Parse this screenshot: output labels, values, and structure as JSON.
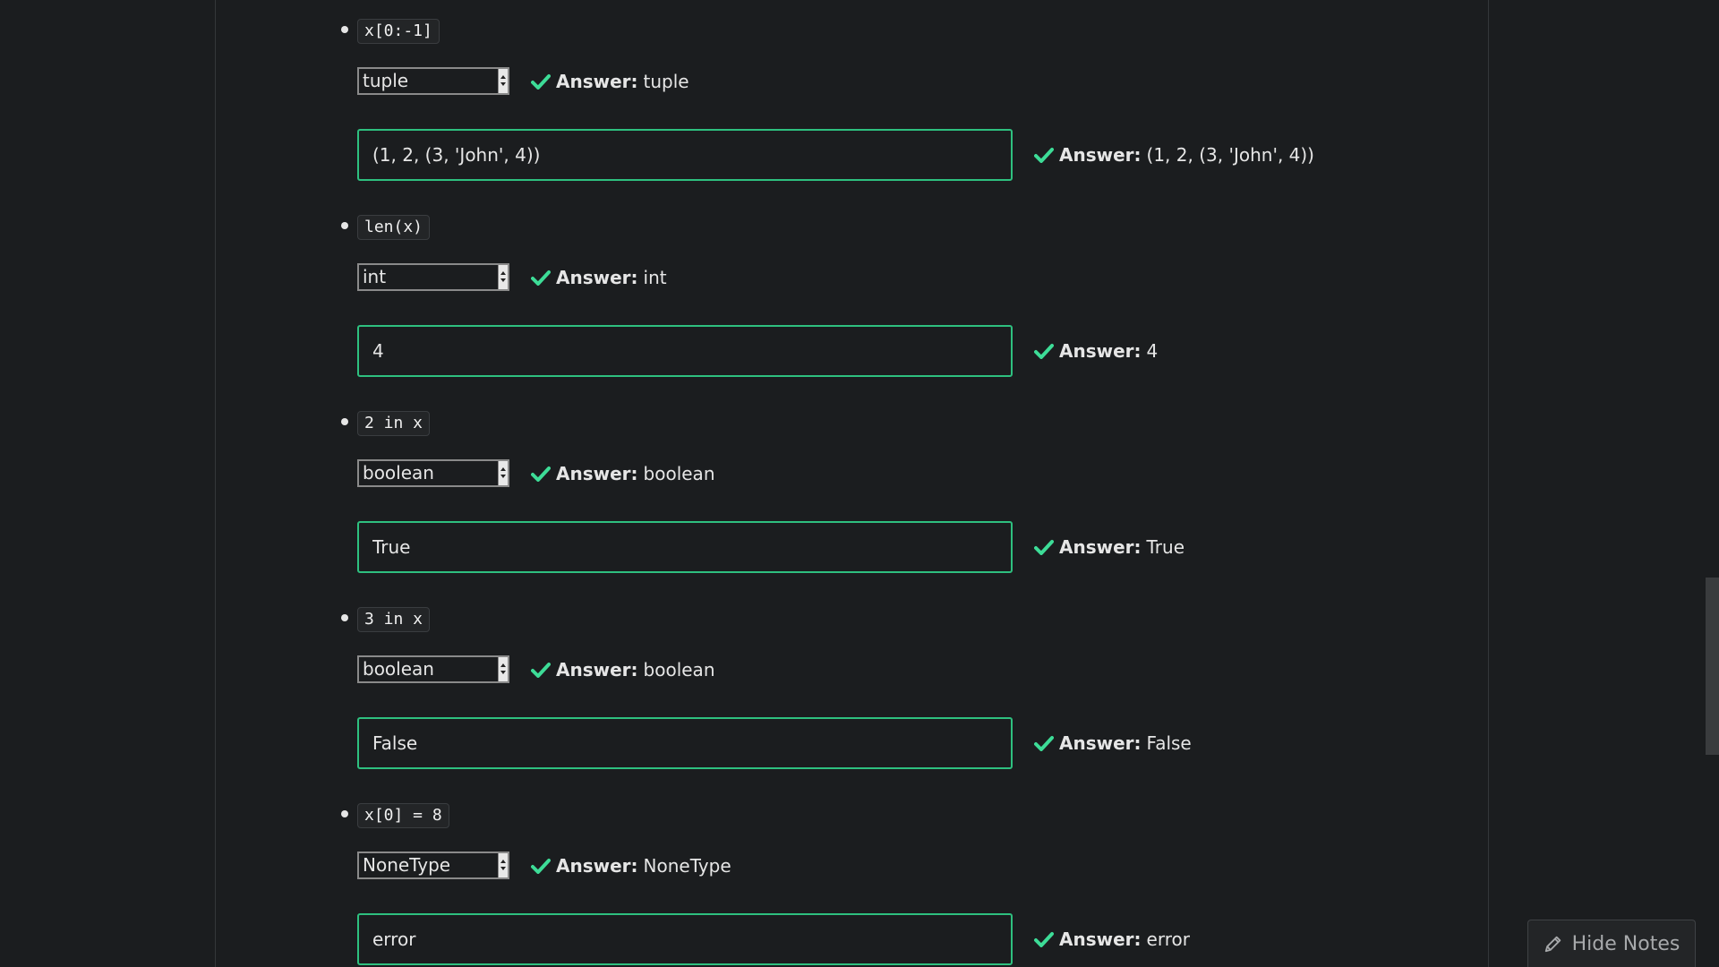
{
  "questions": [
    {
      "code": "x[0:-1]",
      "type_selected": "tuple",
      "type_answer": "tuple",
      "value": "(1, 2, (3, 'John', 4))",
      "value_answer": "(1, 2, (3, 'John', 4))"
    },
    {
      "code": "len(x)",
      "type_selected": "int",
      "type_answer": "int",
      "value": "4",
      "value_answer": "4"
    },
    {
      "code": "2 in x",
      "type_selected": "boolean",
      "type_answer": "boolean",
      "value": "True",
      "value_answer": "True"
    },
    {
      "code": "3 in x",
      "type_selected": "boolean",
      "type_answer": "boolean",
      "value": "False",
      "value_answer": "False"
    },
    {
      "code": "x[0] = 8",
      "type_selected": "NoneType",
      "type_answer": "NoneType",
      "value": "error",
      "value_answer": "error"
    }
  ],
  "answer_label": "Answer:",
  "notes_button": {
    "label": "Hide Notes",
    "icon": "pencil-icon"
  },
  "colors": {
    "background": "#1b1d1f",
    "accent_green": "#2ec07f",
    "check_green": "#3ddc97",
    "text": "#e6e6e6",
    "muted": "#a7a9ab"
  },
  "icons": {
    "correct": "check-icon",
    "dropdown": "select-arrow-icon"
  }
}
